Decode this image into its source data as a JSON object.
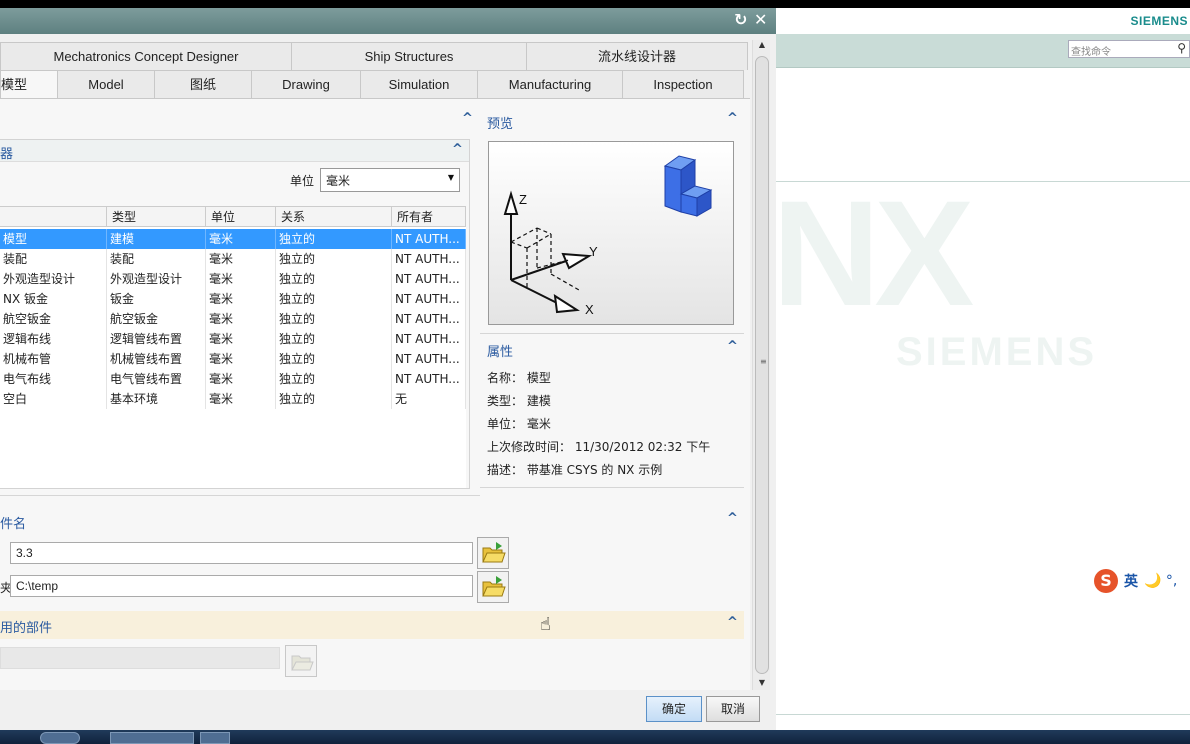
{
  "background_window": {
    "brand": "SIEMENS",
    "command_search_placeholder": "查找命令",
    "watermark": "NX",
    "watermark_sub": "SIEMENS",
    "ime": {
      "logo": "S",
      "mode": "英",
      "icons": "🌙 °,"
    }
  },
  "dialog": {
    "title_buttons": {
      "reset": "↻",
      "close": "✕"
    },
    "tabs_row1": [
      "Mechatronics Concept Designer",
      "Ship Structures",
      "流水线设计器"
    ],
    "tabs_row2": [
      "模型",
      "Model",
      "图纸",
      "Drawing",
      "Simulation",
      "Manufacturing",
      "Inspection"
    ],
    "active_tab": "模型",
    "templates": {
      "section_chevron": "^",
      "filter_title": "器",
      "unit_label": "单位",
      "unit_value": "毫米",
      "columns": [
        "",
        "类型",
        "单位",
        "关系",
        "所有者"
      ],
      "rows": [
        [
          "模型",
          "建模",
          "毫米",
          "独立的",
          "NT AUTH..."
        ],
        [
          "装配",
          "装配",
          "毫米",
          "独立的",
          "NT AUTH..."
        ],
        [
          "外观造型设计",
          "外观造型设计",
          "毫米",
          "独立的",
          "NT AUTH..."
        ],
        [
          "NX 钣金",
          "钣金",
          "毫米",
          "独立的",
          "NT AUTH..."
        ],
        [
          "航空钣金",
          "航空钣金",
          "毫米",
          "独立的",
          "NT AUTH..."
        ],
        [
          "逻辑布线",
          "逻辑管线布置",
          "毫米",
          "独立的",
          "NT AUTH..."
        ],
        [
          "机械布管",
          "机械管线布置",
          "毫米",
          "独立的",
          "NT AUTH..."
        ],
        [
          "电气布线",
          "电气管线布置",
          "毫米",
          "独立的",
          "NT AUTH..."
        ],
        [
          "空白",
          "基本环境",
          "毫米",
          "独立的",
          "无"
        ]
      ],
      "selected_row": 0
    },
    "preview": {
      "title": "预览",
      "axes": {
        "z": "Z",
        "y": "Y",
        "x": "X"
      }
    },
    "properties": {
      "title": "属性",
      "lines": [
        "名称： 模型",
        "类型： 建模",
        "单位： 毫米",
        "上次修改时间： 11/30/2012 02:32 下午",
        "描述： 带基准 CSYS 的 NX 示例"
      ]
    },
    "new_file": {
      "title": "件名",
      "name_value": "3.3",
      "folder_label": "夹",
      "folder_value": "C:\\temp"
    },
    "referenced_part": {
      "title": "用的部件",
      "value": ""
    },
    "buttons": {
      "ok": "确定",
      "cancel": "取消"
    }
  }
}
